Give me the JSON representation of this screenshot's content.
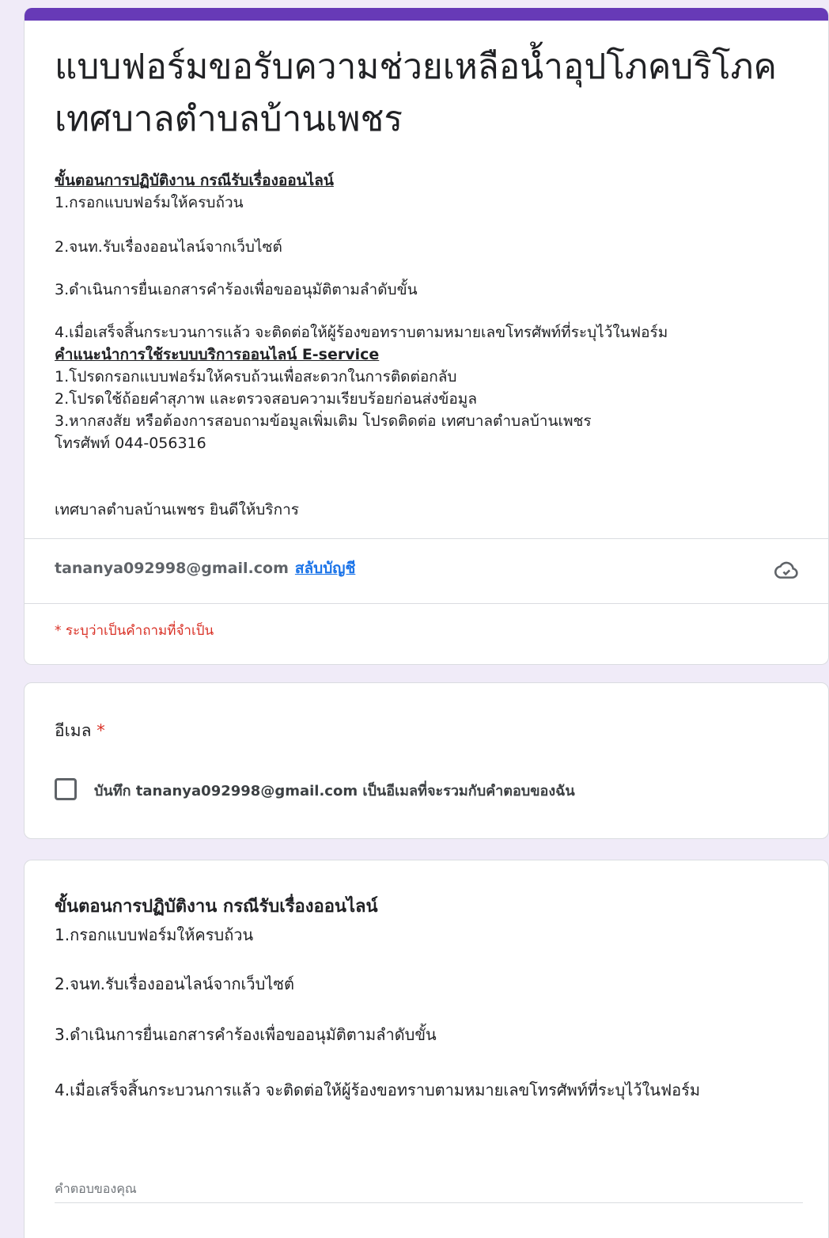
{
  "header": {
    "title": "แบบฟอร์มขอรับความช่วยเหลือน้ำอุปโภคบริโภค เทศบาลตำบลบ้านเพชร",
    "steps_heading": "ขั้นตอนการปฏิบัติงาน กรณีรับเรื่องออนไลน์",
    "step1": "1.กรอกแบบฟอร์มให้ครบถ้วน",
    "step2": "2.จนท.รับเรื่องออนไลน์จากเว็บไซต์",
    "step3": "3.ดำเนินการยื่นเอกสารคำร้องเพื่อขออนุมัติตามลำดับขั้น",
    "step4": "4.เมื่อเสร็จสิ้นกระบวนการแล้ว จะติดต่อให้ผู้ร้องขอทราบตามหมายเลขโทรศัพท์ที่ระบุไว้ในฟอร์ม",
    "guide_heading": "คำแนะนำการใช้ระบบบริการออนไลน์ E-service",
    "guide1": "1.โปรดกรอกแบบฟอร์มให้ครบถ้วนเพื่อสะดวกในการติดต่อกลับ",
    "guide2": "2.โปรดใช้ถ้อยคำสุภาพ และตรวจสอบความเรียบร้อยก่อนส่งข้อมูล",
    "guide3": "3.หากสงสัย หรือต้องการสอบถามข้อมูลเพิ่มเติม โปรดติดต่อ เทศบาลตำบลบ้านเพชร",
    "phone": "โทรศัพท์ 044-056316",
    "closing": "เทศบาลตำบลบ้านเพชร ยินดีให้บริการ",
    "account_email": "tananya092998@gmail.com",
    "switch_account": "สลับบัญชี",
    "required_note": "* ระบุว่าเป็นคำถามที่จำเป็น"
  },
  "email_question": {
    "label": "อีเมล",
    "required_mark": "*",
    "checkbox_label": "บันทึก tananya092998@gmail.com เป็นอีเมลที่จะรวมกับคำตอบของฉัน",
    "checked": false
  },
  "question": {
    "title": "ขั้นตอนการปฏิบัติงาน กรณีรับเรื่องออนไลน์",
    "step1": "1.กรอกแบบฟอร์มให้ครบถ้วน",
    "step2": "2.จนท.รับเรื่องออนไลน์จากเว็บไซต์",
    "step3": "3.ดำเนินการยื่นเอกสารคำร้องเพื่อขออนุมัติตามลำดับขั้น",
    "step4": "4.เมื่อเสร็จสิ้นกระบวนการแล้ว จะติดต่อให้ผู้ร้องขอทราบตามหมายเลขโทรศัพท์ที่ระบุไว้ในฟอร์ม",
    "answer_placeholder": "คำตอบของคุณ",
    "answer_value": ""
  },
  "icons": {
    "cloud": "cloud-save-icon"
  },
  "colors": {
    "accent": "#673ab7",
    "required": "#d93025",
    "link": "#1a73e8",
    "background": "#f0ebf8"
  }
}
